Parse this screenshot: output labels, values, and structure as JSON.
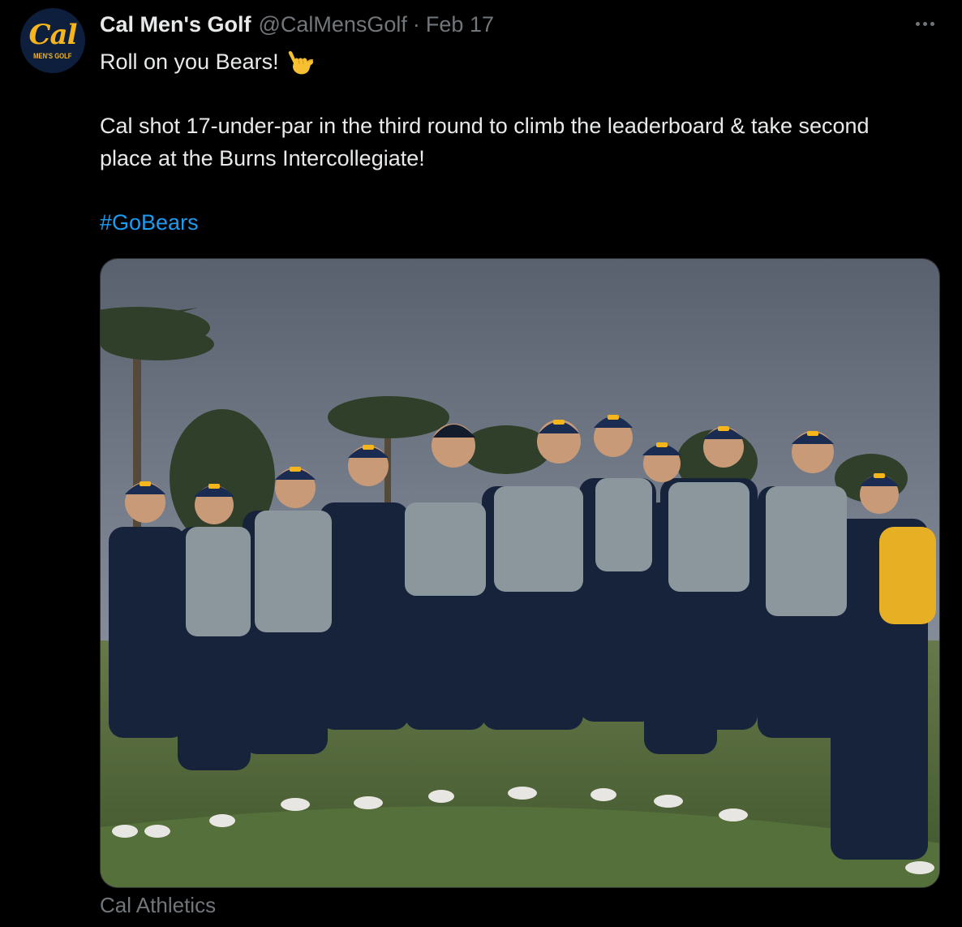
{
  "account": {
    "avatar_text": "Cal",
    "avatar_subtext": "MEN'S GOLF",
    "display_name": "Cal Men's Golf",
    "handle": "@CalMensGolf",
    "separator": "·",
    "date": "Feb 17"
  },
  "post": {
    "line1": "Roll on you Bears!",
    "line1_emoji": "call-me-hand-emoji",
    "line2": "Cal shot 17-under-par in the third round to climb the leaderboard & take second place at the Burns Intercollegiate!",
    "hashtag": "#GoBears"
  },
  "media": {
    "description_type": "photo",
    "cap_logo_text": "Cal",
    "credit": "Cal Athletics"
  },
  "icons": {
    "more": "more-horizontal-icon"
  },
  "colors": {
    "background": "#000000",
    "primary_text": "#e7e9ea",
    "secondary_text": "#71767b",
    "link": "#1d9bf0",
    "cal_gold": "#f5b51b",
    "cal_navy": "#0d1f3c"
  }
}
